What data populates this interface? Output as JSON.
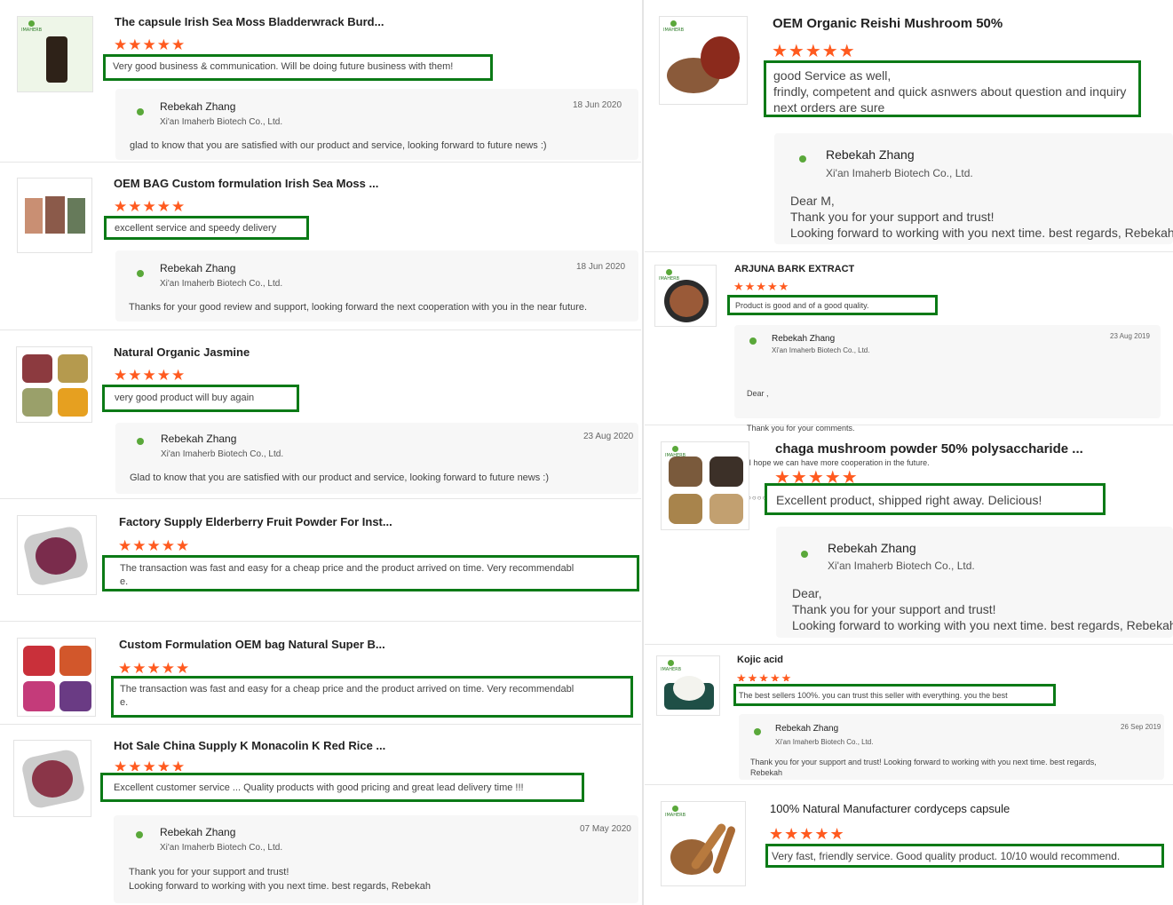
{
  "left_reviews": [
    {
      "product": "The capsule Irish Sea Moss Bladderwrack Burd...",
      "stars": "★★★★★",
      "comment": [
        "Very good business & communication. Will be doing future business with them!"
      ],
      "reply_name": "Rebekah Zhang",
      "reply_company": "Xi'an Imaherb Biotech Co., Ltd.",
      "reply_date": "18 Jun 2020",
      "reply_lines": [
        "glad to know that you are satisfied with our product and service, looking forward to future news :)"
      ]
    },
    {
      "product": "OEM BAG Custom formulation Irish Sea Moss ...",
      "stars": "★★★★★",
      "comment": [
        "excellent service and speedy delivery"
      ],
      "reply_name": "Rebekah Zhang",
      "reply_company": "Xi'an Imaherb Biotech Co., Ltd.",
      "reply_date": "18 Jun 2020",
      "reply_lines": [
        "Thanks for your good review and support, looking forward the next cooperation with you in the near future."
      ]
    },
    {
      "product": "Natural Organic Jasmine",
      "stars": "★★★★★",
      "comment": [
        "very good product will buy again"
      ],
      "reply_name": "Rebekah Zhang",
      "reply_company": "Xi'an Imaherb Biotech Co., Ltd.",
      "reply_date": "23 Aug 2020",
      "reply_lines": [
        "Glad to know that you are satisfied with our product and service, looking forward to future news :)"
      ]
    },
    {
      "product": "Factory Supply Elderberry Fruit Powder For Inst...",
      "stars": "★★★★★",
      "comment": [
        "The transaction was fast and easy for a cheap price and the product arrived on time. Very recommendabl",
        "e."
      ]
    },
    {
      "product": "Custom Formulation OEM bag Natural Super B...",
      "stars": "★★★★★",
      "comment": [
        "The transaction was fast and easy for a cheap price and the product arrived on time. Very recommendabl",
        "e."
      ]
    },
    {
      "product": "Hot Sale China Supply K Monacolin K Red Rice ...",
      "stars": "★★★★★",
      "comment": [
        "Excellent customer service ... Quality products with good pricing and great lead delivery time !!!"
      ],
      "reply_name": "Rebekah Zhang",
      "reply_company": "Xi'an Imaherb Biotech Co., Ltd.",
      "reply_date": "07 May 2020",
      "reply_lines": [
        "Thank you for your support and trust!",
        "Looking forward to working with you next time. best regards, Rebekah"
      ]
    }
  ],
  "right_reviews": [
    {
      "product": "OEM Organic Reishi Mushroom 50%",
      "stars": "★★★★★",
      "comment": [
        "good Service as well,",
        "frindly, competent and quick asnwers about question and inquiry",
        "next orders are sure"
      ],
      "reply_name": "Rebekah Zhang",
      "reply_company": "Xi'an Imaherb Biotech Co., Ltd.",
      "reply_lines": [
        "Dear M,",
        "Thank you for your support and trust!",
        "Looking forward to working with you next time. best regards, Rebekah"
      ]
    },
    {
      "product": "ARJUNA BARK EXTRACT",
      "stars": "★★★★★",
      "comment": [
        "Product is good and of a good quality."
      ],
      "reply_name": "Rebekah Zhang",
      "reply_company": "Xi'an Imaherb Biotech Co., Ltd.",
      "reply_date": "23 Aug 2019",
      "reply_lines": [
        "Dear ,",
        "Thank you for your comments.",
        " I hope we can have more cooperation in the future.",
        "○○○○○"
      ]
    },
    {
      "product": "chaga mushroom powder 50% polysaccharide ...",
      "stars": "★★★★★",
      "comment": [
        "Excellent product, shipped right away. Delicious!"
      ],
      "reply_name": "Rebekah Zhang",
      "reply_company": "Xi'an Imaherb Biotech Co., Ltd.",
      "reply_lines": [
        "Dear,",
        "Thank you for your support and trust!",
        "Looking forward to working with you next time. best regards, Rebekah"
      ]
    },
    {
      "product": "Kojic acid",
      "stars": "★★★★★",
      "comment": [
        "The best sellers 100%. you can trust this seller with everything. you the best"
      ],
      "reply_name": "Rebekah Zhang",
      "reply_company": "Xi'an Imaherb Biotech Co., Ltd.",
      "reply_date": "26 Sep 2019",
      "reply_lines": [
        "Thank you for your support and trust! Looking forward to working with you next time. best regards,",
        "Rebekah"
      ]
    },
    {
      "product": "100% Natural Manufacturer cordyceps capsule",
      "stars": "★★★★★",
      "comment": [
        "Very fast, friendly service. Good quality product. 10/10 would recommend."
      ]
    }
  ],
  "thumb_brand_text": "IMAHERB",
  "colors": {
    "accent_green": "#0b7a16",
    "star_orange": "#ff5a1f"
  }
}
